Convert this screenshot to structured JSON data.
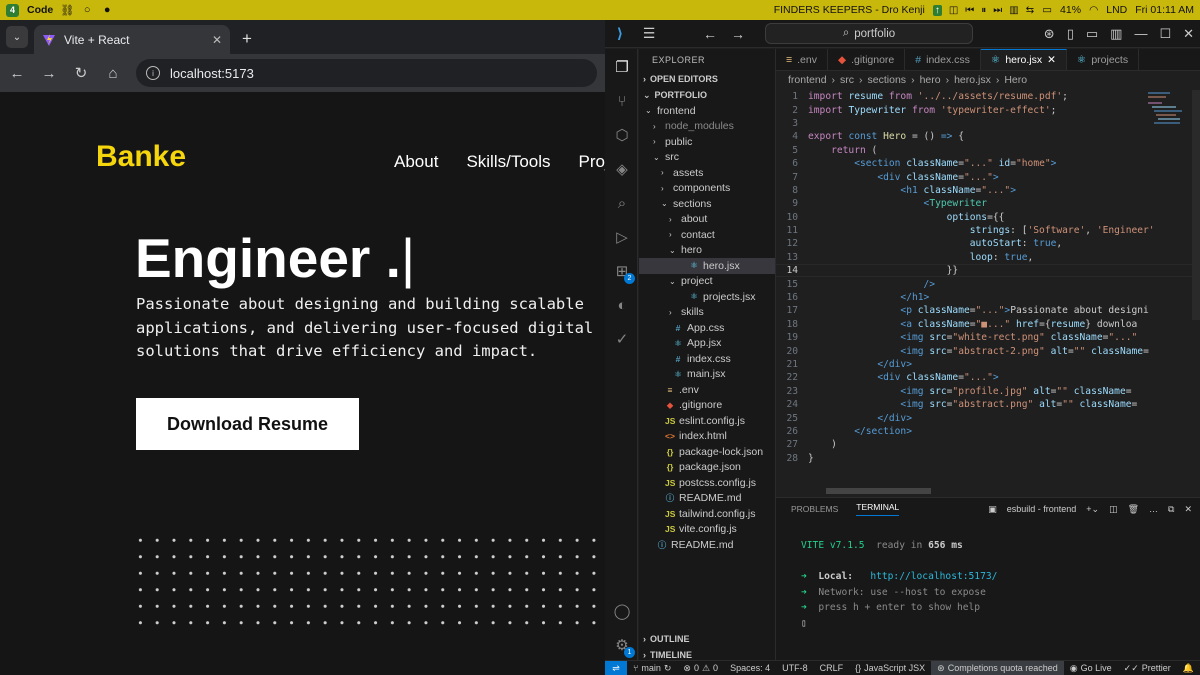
{
  "topbar": {
    "badge": "4",
    "app": "Code",
    "now_playing": "FINDERS KEEPERS - Dro Kenji",
    "battery": "41%",
    "lang": "LND",
    "time": "Fri 01:11 AM"
  },
  "browser": {
    "tab_title": "Vite + React",
    "url": "localhost:5173"
  },
  "site": {
    "logo": "Banke",
    "nav": [
      "About",
      "Skills/Tools",
      "Proj"
    ],
    "headline": "Engineer .",
    "cursor": "|",
    "tagline": "Passionate about designing and building scalable applications, and delivering user-focused digital solutions that drive efficiency and impact.",
    "download_label": "Download Resume"
  },
  "vscode": {
    "command_center": "portfolio",
    "explorer_title": "EXPLORER",
    "open_editors": "OPEN EDITORS",
    "project": "PORTFOLIO",
    "tree": [
      {
        "label": "frontend",
        "type": "folder-open",
        "depth": 1
      },
      {
        "label": "node_modules",
        "type": "folder",
        "depth": 2,
        "dim": true
      },
      {
        "label": "public",
        "type": "folder",
        "depth": 2
      },
      {
        "label": "src",
        "type": "folder-open",
        "depth": 2
      },
      {
        "label": "assets",
        "type": "folder",
        "depth": 3
      },
      {
        "label": "components",
        "type": "folder",
        "depth": 3
      },
      {
        "label": "sections",
        "type": "folder-open",
        "depth": 3
      },
      {
        "label": "about",
        "type": "folder",
        "depth": 4
      },
      {
        "label": "contact",
        "type": "folder",
        "depth": 4
      },
      {
        "label": "hero",
        "type": "folder-open",
        "depth": 4
      },
      {
        "label": "hero.jsx",
        "type": "jsx",
        "depth": 5,
        "selected": true
      },
      {
        "label": "project",
        "type": "folder-open",
        "depth": 4
      },
      {
        "label": "projects.jsx",
        "type": "jsx",
        "depth": 5
      },
      {
        "label": "skills",
        "type": "folder",
        "depth": 4
      },
      {
        "label": "App.css",
        "type": "css",
        "depth": 3
      },
      {
        "label": "App.jsx",
        "type": "jsx",
        "depth": 3
      },
      {
        "label": "index.css",
        "type": "css",
        "depth": 3
      },
      {
        "label": "main.jsx",
        "type": "jsx",
        "depth": 3
      },
      {
        "label": ".env",
        "type": "env",
        "depth": 2
      },
      {
        "label": ".gitignore",
        "type": "git",
        "depth": 2
      },
      {
        "label": "eslint.config.js",
        "type": "js",
        "depth": 2
      },
      {
        "label": "index.html",
        "type": "html",
        "depth": 2
      },
      {
        "label": "package-lock.json",
        "type": "json",
        "depth": 2
      },
      {
        "label": "package.json",
        "type": "json",
        "depth": 2
      },
      {
        "label": "postcss.config.js",
        "type": "js",
        "depth": 2
      },
      {
        "label": "README.md",
        "type": "md",
        "depth": 2
      },
      {
        "label": "tailwind.config.js",
        "type": "js",
        "depth": 2
      },
      {
        "label": "vite.config.js",
        "type": "js",
        "depth": 2
      },
      {
        "label": "README.md",
        "type": "md",
        "depth": 1
      }
    ],
    "tabs": [
      {
        "label": ".env",
        "icon": "≡"
      },
      {
        "label": ".gitignore",
        "icon": "◆"
      },
      {
        "label": "index.css",
        "icon": "#"
      },
      {
        "label": "hero.jsx",
        "icon": "⚛",
        "active": true
      },
      {
        "label": "projects",
        "icon": "⚛"
      }
    ],
    "breadcrumb": [
      "frontend",
      "src",
      "sections",
      "hero",
      "hero.jsx",
      "Hero"
    ],
    "code_lines": [
      [
        [
          "kw",
          "import"
        ],
        [
          "pn",
          " "
        ],
        [
          "vr",
          "resume"
        ],
        [
          "pn",
          " "
        ],
        [
          "kw",
          "from"
        ],
        [
          "pn",
          " "
        ],
        [
          "st",
          "'../../assets/resume.pdf'"
        ],
        [
          "pn",
          ";"
        ]
      ],
      [
        [
          "kw",
          "import"
        ],
        [
          "pn",
          " "
        ],
        [
          "vr",
          "Typewriter"
        ],
        [
          "pn",
          " "
        ],
        [
          "kw",
          "from"
        ],
        [
          "pn",
          " "
        ],
        [
          "st",
          "'typewriter-effect'"
        ],
        [
          "pn",
          ";"
        ]
      ],
      [],
      [
        [
          "kw",
          "export"
        ],
        [
          "pn",
          " "
        ],
        [
          "kb",
          "const"
        ],
        [
          "pn",
          " "
        ],
        [
          "fn",
          "Hero"
        ],
        [
          "pn",
          " = () "
        ],
        [
          "kb",
          "=>"
        ],
        [
          "pn",
          " {"
        ]
      ],
      [
        [
          "pn",
          "    "
        ],
        [
          "kw",
          "return"
        ],
        [
          "pn",
          " ("
        ]
      ],
      [
        [
          "pn",
          "        "
        ],
        [
          "tg",
          "<section"
        ],
        [
          "pn",
          " "
        ],
        [
          "at",
          "className"
        ],
        [
          "pn",
          "="
        ],
        [
          "st",
          "\"...\""
        ],
        [
          "pn",
          " "
        ],
        [
          "at",
          "id"
        ],
        [
          "pn",
          "="
        ],
        [
          "st",
          "\"home\""
        ],
        [
          "tg",
          ">"
        ]
      ],
      [
        [
          "pn",
          "            "
        ],
        [
          "tg",
          "<div"
        ],
        [
          "pn",
          " "
        ],
        [
          "at",
          "className"
        ],
        [
          "pn",
          "="
        ],
        [
          "st",
          "\"...\""
        ],
        [
          "tg",
          ">"
        ]
      ],
      [
        [
          "pn",
          "                "
        ],
        [
          "tg",
          "<h1"
        ],
        [
          "pn",
          " "
        ],
        [
          "at",
          "className"
        ],
        [
          "pn",
          "="
        ],
        [
          "st",
          "\"...\""
        ],
        [
          "tg",
          ">"
        ]
      ],
      [
        [
          "pn",
          "                    "
        ],
        [
          "tg",
          "<"
        ],
        [
          "cp",
          "Typewriter"
        ]
      ],
      [
        [
          "pn",
          "                        "
        ],
        [
          "at",
          "options"
        ],
        [
          "pn",
          "={{"
        ]
      ],
      [
        [
          "pn",
          "                            "
        ],
        [
          "vr",
          "strings"
        ],
        [
          "pn",
          ": ["
        ],
        [
          "st",
          "'Software'"
        ],
        [
          "pn",
          ", "
        ],
        [
          "st",
          "'Engineer'"
        ]
      ],
      [
        [
          "pn",
          "                            "
        ],
        [
          "vr",
          "autoStart"
        ],
        [
          "pn",
          ": "
        ],
        [
          "kb",
          "true"
        ],
        [
          "pn",
          ","
        ]
      ],
      [
        [
          "pn",
          "                            "
        ],
        [
          "vr",
          "loop"
        ],
        [
          "pn",
          ": "
        ],
        [
          "kb",
          "true"
        ],
        [
          "pn",
          ","
        ]
      ],
      [
        [
          "pn",
          "                        }}"
        ]
      ],
      [
        [
          "pn",
          "                    "
        ],
        [
          "tg",
          "/>"
        ]
      ],
      [
        [
          "pn",
          "                "
        ],
        [
          "tg",
          "</h1>"
        ]
      ],
      [
        [
          "pn",
          "                "
        ],
        [
          "tg",
          "<p"
        ],
        [
          "pn",
          " "
        ],
        [
          "at",
          "className"
        ],
        [
          "pn",
          "="
        ],
        [
          "st",
          "\"...\""
        ],
        [
          "tg",
          ">"
        ],
        [
          "pn",
          "Passionate about designi"
        ]
      ],
      [
        [
          "pn",
          "                "
        ],
        [
          "tg",
          "<a"
        ],
        [
          "pn",
          " "
        ],
        [
          "at",
          "className"
        ],
        [
          "pn",
          "="
        ],
        [
          "st",
          "\"■...\""
        ],
        [
          "pn",
          " "
        ],
        [
          "at",
          "href"
        ],
        [
          "pn",
          "={"
        ],
        [
          "vr",
          "resume"
        ],
        [
          "pn",
          "} downloa"
        ]
      ],
      [
        [
          "pn",
          "                "
        ],
        [
          "tg",
          "<img"
        ],
        [
          "pn",
          " "
        ],
        [
          "at",
          "src"
        ],
        [
          "pn",
          "="
        ],
        [
          "st",
          "\"white-rect.png\""
        ],
        [
          "pn",
          " "
        ],
        [
          "at",
          "className"
        ],
        [
          "pn",
          "="
        ],
        [
          "st",
          "\"...\""
        ]
      ],
      [
        [
          "pn",
          "                "
        ],
        [
          "tg",
          "<img"
        ],
        [
          "pn",
          " "
        ],
        [
          "at",
          "src"
        ],
        [
          "pn",
          "="
        ],
        [
          "st",
          "\"abstract-2.png\""
        ],
        [
          "pn",
          " "
        ],
        [
          "at",
          "alt"
        ],
        [
          "pn",
          "="
        ],
        [
          "st",
          "\"\""
        ],
        [
          "pn",
          " "
        ],
        [
          "at",
          "className"
        ],
        [
          "pn",
          "="
        ]
      ],
      [
        [
          "pn",
          "            "
        ],
        [
          "tg",
          "</div>"
        ]
      ],
      [
        [
          "pn",
          "            "
        ],
        [
          "tg",
          "<div"
        ],
        [
          "pn",
          " "
        ],
        [
          "at",
          "className"
        ],
        [
          "pn",
          "="
        ],
        [
          "st",
          "\"...\""
        ],
        [
          "tg",
          ">"
        ]
      ],
      [
        [
          "pn",
          "                "
        ],
        [
          "tg",
          "<img"
        ],
        [
          "pn",
          " "
        ],
        [
          "at",
          "src"
        ],
        [
          "pn",
          "="
        ],
        [
          "st",
          "\"profile.jpg\""
        ],
        [
          "pn",
          " "
        ],
        [
          "at",
          "alt"
        ],
        [
          "pn",
          "="
        ],
        [
          "st",
          "\"\""
        ],
        [
          "pn",
          " "
        ],
        [
          "at",
          "className"
        ],
        [
          "pn",
          "="
        ]
      ],
      [
        [
          "pn",
          "                "
        ],
        [
          "tg",
          "<img"
        ],
        [
          "pn",
          " "
        ],
        [
          "at",
          "src"
        ],
        [
          "pn",
          "="
        ],
        [
          "st",
          "\"abstract.png\""
        ],
        [
          "pn",
          " "
        ],
        [
          "at",
          "alt"
        ],
        [
          "pn",
          "="
        ],
        [
          "st",
          "\"\""
        ],
        [
          "pn",
          " "
        ],
        [
          "at",
          "className"
        ],
        [
          "pn",
          "="
        ]
      ],
      [
        [
          "pn",
          "            "
        ],
        [
          "tg",
          "</div>"
        ]
      ],
      [
        [
          "pn",
          "        "
        ],
        [
          "tg",
          "</section>"
        ]
      ],
      [
        [
          "pn",
          "    )"
        ]
      ],
      [
        [
          "pn",
          "}"
        ]
      ]
    ],
    "current_line": 14,
    "panel_tabs": [
      "PROBLEMS",
      "TERMINAL"
    ],
    "terminal_name": "esbuild - frontend",
    "terminal": {
      "vite": "VITE v7.1.5",
      "ready": "ready in",
      "ms": "656 ms",
      "local_label": "Local:",
      "local_url": "http://localhost:5173/",
      "network_label": "Network:",
      "network_text": "use --host to expose",
      "help": "press h + enter to show help"
    },
    "outline": "OUTLINE",
    "timeline": "TIMELINE",
    "status": {
      "branch": "main",
      "problems": "0",
      "warnings": "0",
      "spaces": "Spaces: 4",
      "encoding": "UTF-8",
      "eol": "CRLF",
      "language": "JavaScript JSX",
      "quota": "Completions quota reached",
      "golive": "Go Live",
      "prettier": "Prettier"
    }
  },
  "colors": {
    "logo_yellow": "#f5d50b",
    "topbar": "#c9b80c",
    "accent_blue": "#0078d4"
  }
}
